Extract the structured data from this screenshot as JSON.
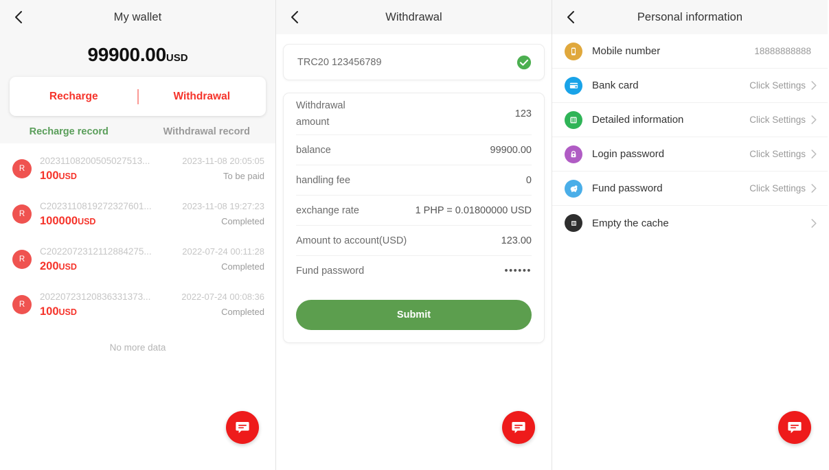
{
  "colors": {
    "accent_red": "#f5332a",
    "fab_red": "#ee1b1b",
    "tab_active_green": "#5a9e5a",
    "submit_green": "#5c9e4e",
    "check_green": "#4caf50"
  },
  "wallet": {
    "title": "My wallet",
    "balance_amount": "99900.00",
    "balance_currency": "USD",
    "actions": {
      "recharge": "Recharge",
      "withdrawal": "Withdrawal"
    },
    "tabs": [
      {
        "label": "Recharge record",
        "active": true
      },
      {
        "label": "Withdrawal record",
        "active": false
      }
    ],
    "records": [
      {
        "avatar": "R",
        "id": "20231108200505027513...",
        "time": "2023-11-08 20:05:05",
        "amount": "100",
        "currency": "USD",
        "status": "To be paid"
      },
      {
        "avatar": "R",
        "id": "C2023110819272327601...",
        "time": "2023-11-08 19:27:23",
        "amount": "100000",
        "currency": "USD",
        "status": "Completed"
      },
      {
        "avatar": "R",
        "id": "C2022072312112884275...",
        "time": "2022-07-24 00:11:28",
        "amount": "200",
        "currency": "USD",
        "status": "Completed"
      },
      {
        "avatar": "R",
        "id": "20220723120836331373...",
        "time": "2022-07-24 00:08:36",
        "amount": "100",
        "currency": "USD",
        "status": "Completed"
      }
    ],
    "no_more_data": "No more data"
  },
  "withdrawal": {
    "title": "Withdrawal",
    "address": "TRC20 123456789",
    "fields": [
      {
        "label": "Withdrawal amount",
        "value": "123"
      },
      {
        "label": "balance",
        "value": "99900.00"
      },
      {
        "label": "handling fee",
        "value": "0"
      },
      {
        "label": "exchange rate",
        "value": "1 PHP = 0.01800000 USD"
      },
      {
        "label": "Amount to account(USD)",
        "value": "123.00"
      }
    ],
    "fund_password_label": "Fund password",
    "fund_password_value": "••••••",
    "submit_label": "Submit"
  },
  "personal": {
    "title": "Personal information",
    "rows": [
      {
        "icon": "mobile-phone-icon",
        "label": "Mobile number",
        "value": "18888888888",
        "chevron": false
      },
      {
        "icon": "bank-card-icon",
        "label": "Bank card",
        "value": "Click Settings",
        "chevron": true
      },
      {
        "icon": "detailed-info-icon",
        "label": "Detailed information",
        "value": "Click Settings",
        "chevron": true
      },
      {
        "icon": "lock-icon",
        "label": "Login password",
        "value": "Click Settings",
        "chevron": true
      },
      {
        "icon": "piggy-bank-icon",
        "label": "Fund password",
        "value": "Click Settings",
        "chevron": true
      },
      {
        "icon": "trash-icon",
        "label": "Empty the cache",
        "value": "",
        "chevron": true
      }
    ]
  },
  "chat_fab": {
    "icon": "chat-bubble-icon"
  }
}
